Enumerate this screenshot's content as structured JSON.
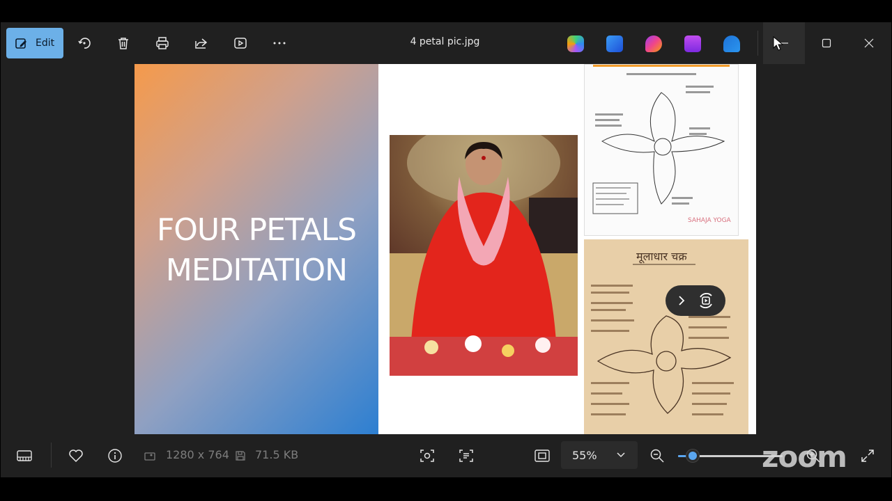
{
  "window": {
    "title": "4 petal pic.jpg"
  },
  "toolbar": {
    "edit_label": "Edit",
    "icons": [
      "rotate-icon",
      "delete-icon",
      "print-icon",
      "share-icon",
      "slideshow-icon",
      "more-icon"
    ]
  },
  "app_icons": [
    "copilot-icon",
    "designer-icon",
    "clipchamp-icon",
    "film-icon",
    "onedrive-icon"
  ],
  "slide": {
    "title_line1": "FOUR PETALS",
    "title_line2": "MEDITATION",
    "diagram_top_footer": "SAHAJA YOGA",
    "diagram_bottom_header": "मूलाधार चक्र"
  },
  "status": {
    "dimensions": "1280 x 764",
    "file_size": "71.5 KB",
    "zoom_value": "55%",
    "zoom_fraction": 0.14
  },
  "watermark": "zoom",
  "colors": {
    "accent": "#6cb0e8",
    "slider": "#5aa6f0",
    "background": "#202020"
  }
}
